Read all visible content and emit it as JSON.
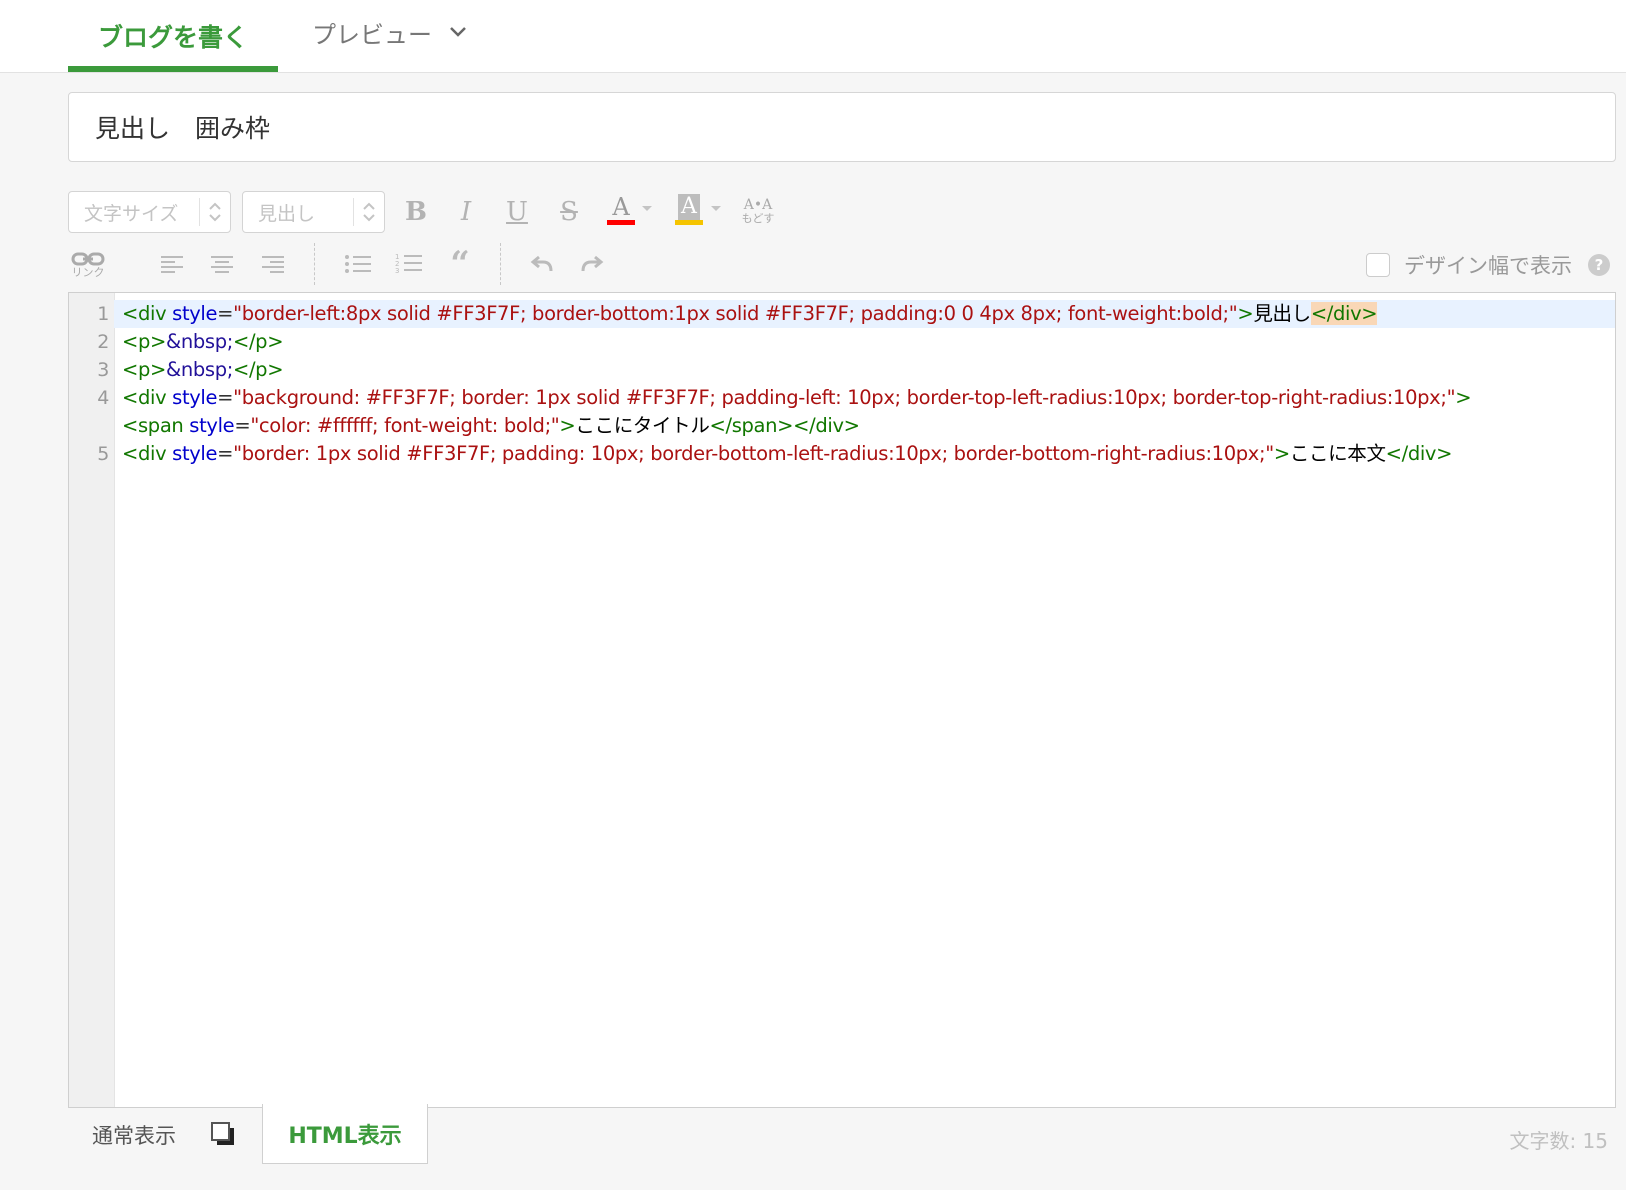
{
  "header": {
    "tab_write": "ブログを書く",
    "tab_preview": "プレビュー",
    "accent_color": "#3b9a3b"
  },
  "title_input": {
    "value": "見出し　囲み枠"
  },
  "toolbar": {
    "font_size_select": "文字サイズ",
    "heading_select": "見出し",
    "bold": "B",
    "italic": "I",
    "underline": "U",
    "strike": "S",
    "font_color": "A",
    "bg_color": "A",
    "reset_top": "A•A",
    "reset_label": "もどす",
    "link_label": "リンク",
    "font_color_bar": "#ff0000",
    "bg_color_bar": "#f5c400",
    "design_width_label": "デザイン幅で表示",
    "help": "?"
  },
  "code_lines": [
    {
      "n": "1"
    },
    {
      "n": "2"
    },
    {
      "n": "3"
    },
    {
      "n": "4"
    },
    {
      "n": ""
    },
    {
      "n": "5"
    }
  ],
  "code": {
    "l1_attr": "style",
    "l1_str": "\"border-left:8px solid #FF3F7F; border-bottom:1px solid #FF3F7F; padding:0 0 4px 8px; font-weight:bold;\"",
    "l1_text": "見出し",
    "l2_entity": "&nbsp;",
    "l4_attr": "style",
    "l4_str": "\"background: #FF3F7F; border: 1px solid #FF3F7F; padding-left: 10px; border-top-left-radius:10px; border-top-right-radius:10px;\"",
    "l4b_attr": "style",
    "l4b_str": "\"color: #ffffff; font-weight: bold;\"",
    "l4b_text": "ここにタイトル",
    "l5_attr": "style",
    "l5_str": "\"border: 1px solid #FF3F7F; padding: 10px; border-bottom-left-radius:10px; border-bottom-right-radius:10px;\"",
    "l5_text": "ここに本文",
    "tag_div_open": "<div",
    "tag_span_open": "<span",
    "tag_close_bracket": ">",
    "tag_div_close": "</div>",
    "tag_span_close": "</span>",
    "tag_p_open": "<p>",
    "tag_p_close": "</p>",
    "eq": "="
  },
  "footer": {
    "normal_view": "通常表示",
    "html_view": "HTML表示",
    "char_count": "文字数: 15"
  }
}
